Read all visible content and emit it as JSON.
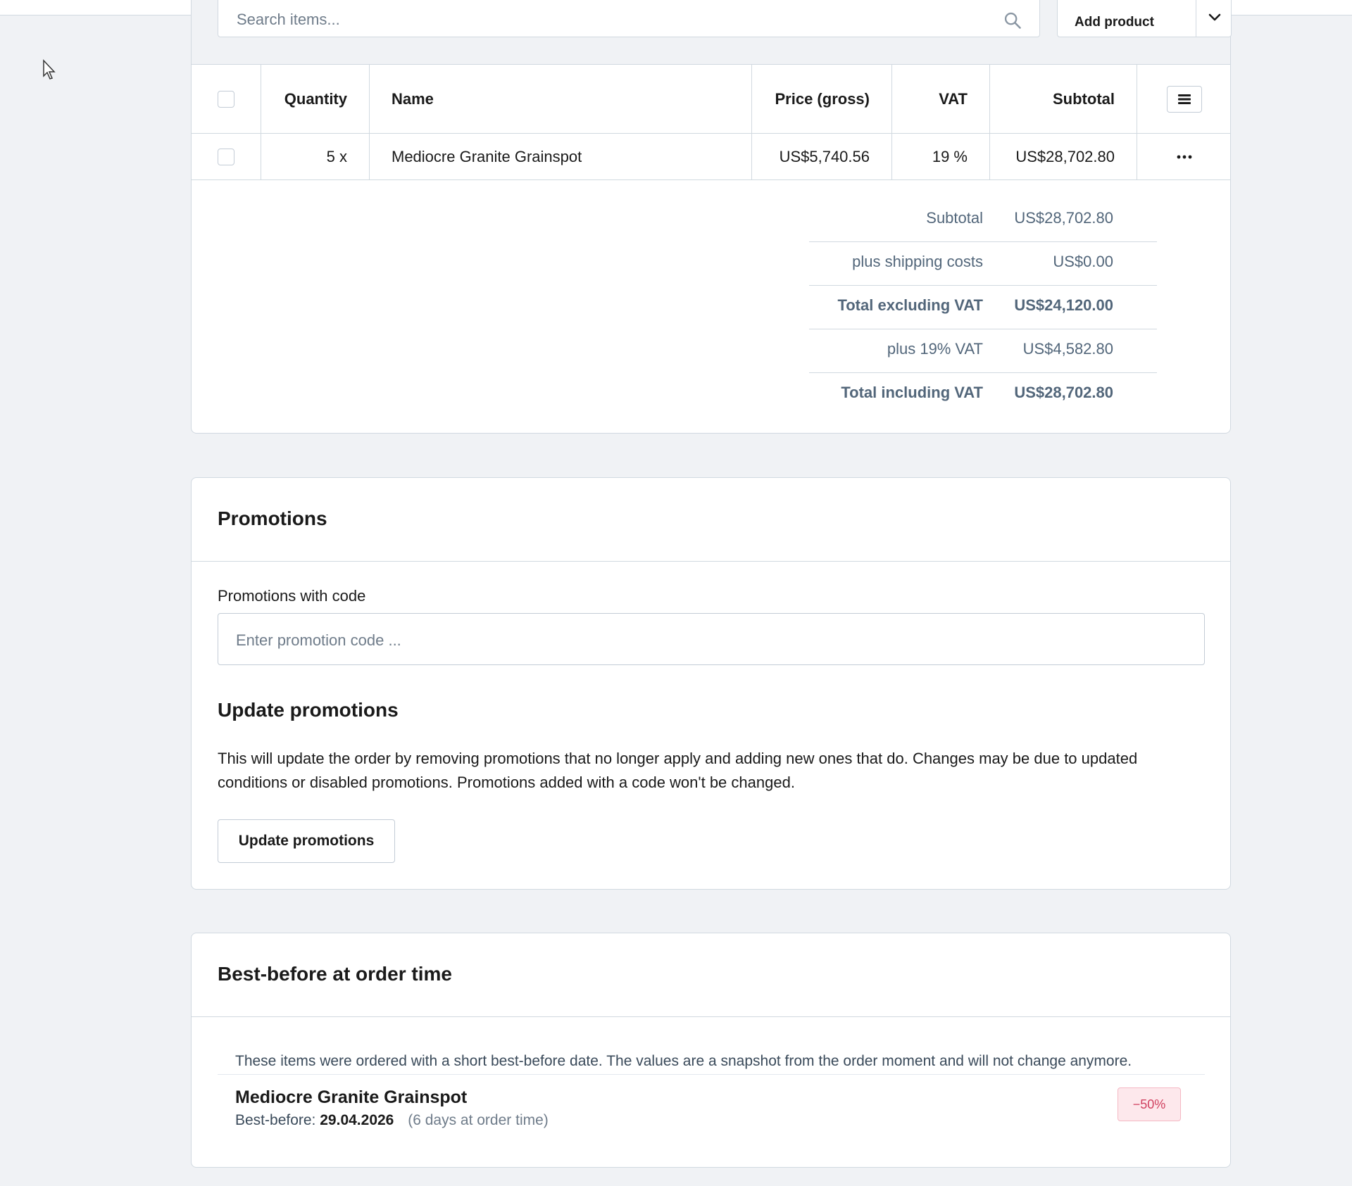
{
  "search": {
    "placeholder": "Search items..."
  },
  "toolbar": {
    "add_product_label": "Add product"
  },
  "table": {
    "headers": {
      "quantity": "Quantity",
      "name": "Name",
      "price": "Price (gross)",
      "vat": "VAT",
      "subtotal": "Subtotal"
    },
    "rows": [
      {
        "quantity": "5 x",
        "name": "Mediocre Granite Grainspot",
        "price": "US$5,740.56",
        "vat": "19 %",
        "subtotal": "US$28,702.80",
        "menu": "···"
      }
    ]
  },
  "summary": [
    {
      "label": "Subtotal",
      "value": "US$28,702.80"
    },
    {
      "label": "plus shipping costs",
      "value": "US$0.00"
    },
    {
      "label": "Total excluding VAT",
      "value": "US$24,120.00"
    },
    {
      "label": "plus 19% VAT",
      "value": "US$4,582.80"
    },
    {
      "label": "Total including VAT",
      "value": "US$28,702.80"
    }
  ],
  "promotions": {
    "title": "Promotions",
    "code_label": "Promotions with code",
    "code_placeholder": "Enter promotion code ...",
    "update_title": "Update promotions",
    "update_text": "This will update the order by removing promotions that no longer apply and adding new ones that do. Changes may be due to updated conditions or disabled promotions. Promotions added with a code won't be changed.",
    "update_button": "Update promotions"
  },
  "best_before": {
    "title": "Best-before at order time",
    "note": "These items were ordered with a short best-before date. The values are a snapshot from the order moment and will not change anymore.",
    "items": [
      {
        "name": "Mediocre Granite Grainspot",
        "date_label": "Best-before:",
        "date": "29.04.2026",
        "days": "(6 days at order time)",
        "badge": "−50%"
      }
    ]
  },
  "colors": {
    "page_bg": "#f0f2f5",
    "border": "#d1d9e0",
    "summary_text": "#52667a",
    "badge_text": "#d0405f",
    "badge_bg": "#fde8ec"
  }
}
